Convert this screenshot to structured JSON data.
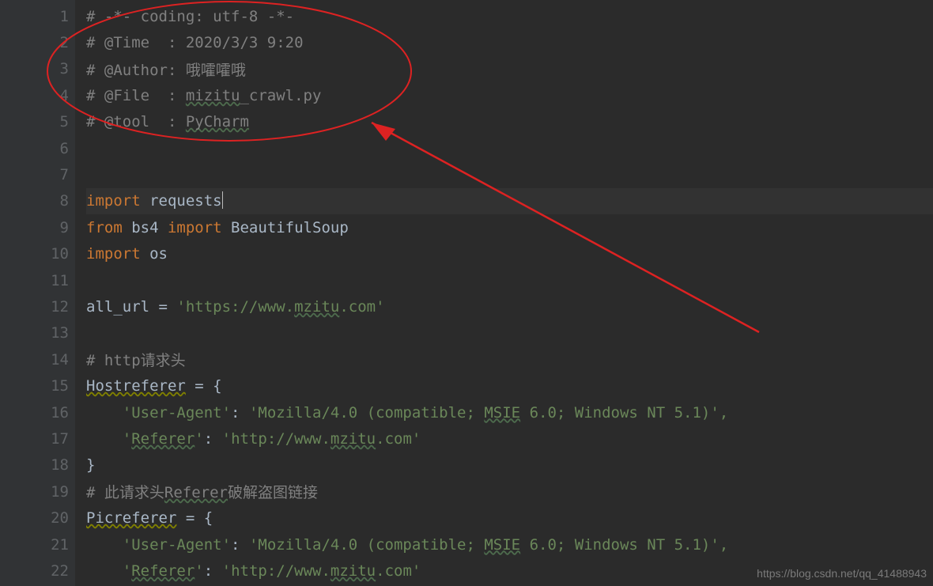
{
  "gutter": {
    "numbers": [
      "1",
      "2",
      "3",
      "4",
      "5",
      "6",
      "7",
      "8",
      "9",
      "10",
      "11",
      "12",
      "13",
      "14",
      "15",
      "16",
      "17",
      "18",
      "19",
      "20",
      "21",
      "22"
    ]
  },
  "code": {
    "l1": "# -*- coding: utf-8 -*-",
    "l2": "# @Time  : 2020/3/3 9:20",
    "l3": "# @Author: 哦嚯嚯哦",
    "l4_a": "# @File  : ",
    "l4_b": "mizitu",
    "l4_c": "_crawl.py",
    "l5_a": "# @tool  : ",
    "l5_b": "PyCharm",
    "l8_kw": "import",
    "l8_mod": " requests",
    "l9_from": "from",
    "l9_mod": " bs4 ",
    "l9_imp": "import",
    "l9_name": " BeautifulSoup",
    "l10_kw": "import",
    "l10_mod": " os",
    "l12_a": "all_url = ",
    "l12_s1": "'https://www.",
    "l12_s2": "mzitu",
    "l12_s3": ".com'",
    "l14": "# http请求头",
    "l15_a": "Hostreferer",
    "l15_b": " = {",
    "l16_a": "    ",
    "l16_s1": "'User-Agent'",
    "l16_b": ": ",
    "l16_s2": "'Mozilla/4.0 (compatible; ",
    "l16_s3": "MSIE",
    "l16_s4": " 6.0; Windows NT 5.1)',",
    "l17_a": "    ",
    "l17_s1": "'",
    "l17_s1b": "Referer",
    "l17_s1c": "'",
    "l17_b": ": ",
    "l17_s2": "'http://www.",
    "l17_s3": "mzitu",
    "l17_s4": ".com'",
    "l18": "}",
    "l19_a": "# 此请求头",
    "l19_b": "Referer",
    "l19_c": "破解盗图链接",
    "l20_a": "Picreferer",
    "l20_b": " = {",
    "l21_a": "    ",
    "l21_s1": "'User-Agent'",
    "l21_b": ": ",
    "l21_s2": "'Mozilla/4.0 (compatible; ",
    "l21_s3": "MSIE",
    "l21_s4": " 6.0; Windows NT 5.1)',",
    "l22_a": "    ",
    "l22_s1": "'",
    "l22_s1b": "Referer",
    "l22_s1c": "'",
    "l22_b": ": ",
    "l22_s2": "'http://www.",
    "l22_s3": "mzitu",
    "l22_s4": ".com'"
  },
  "watermark": "https://blog.csdn.net/qq_41488943"
}
